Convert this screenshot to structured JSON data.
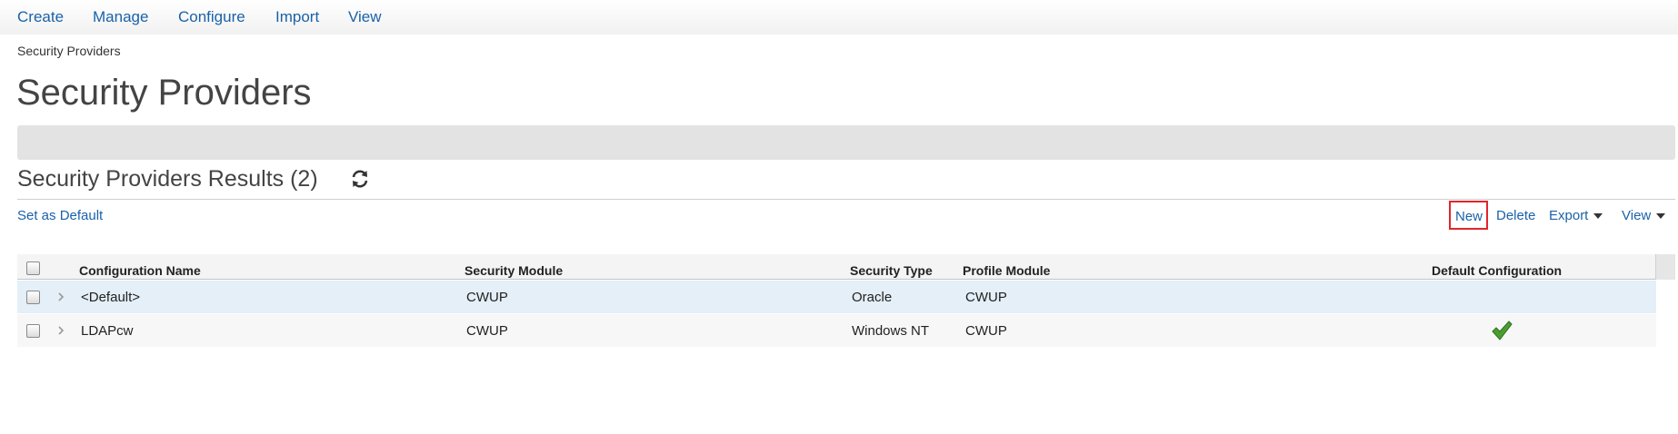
{
  "nav": {
    "items": [
      "Create",
      "Manage",
      "Configure",
      "Import",
      "View"
    ]
  },
  "breadcrumb": "Security Providers",
  "page_title": "Security Providers",
  "results": {
    "title": "Security Providers Results (2)"
  },
  "toolbar": {
    "set_default": "Set as Default",
    "new": "New",
    "delete": "Delete",
    "export": "Export",
    "view": "View"
  },
  "table": {
    "columns": [
      "Configuration Name",
      "Security Module",
      "Security Type",
      "Profile Module",
      "Default Configuration"
    ],
    "rows": [
      {
        "name": "<Default>",
        "security_module": "CWUP",
        "security_type": "Oracle",
        "profile_module": "CWUP",
        "default": false
      },
      {
        "name": "LDAPcw",
        "security_module": "CWUP",
        "security_type": "Windows NT",
        "profile_module": "CWUP",
        "default": true
      }
    ]
  },
  "colors": {
    "link": "#1a62a8",
    "highlight_border": "#e0262b",
    "selected_row": "#e4eff7",
    "check_green": "#4a9e2f"
  },
  "icons": {
    "refresh": "refresh-icon",
    "expand": "chevron-right-icon",
    "default_check": "check-icon"
  }
}
